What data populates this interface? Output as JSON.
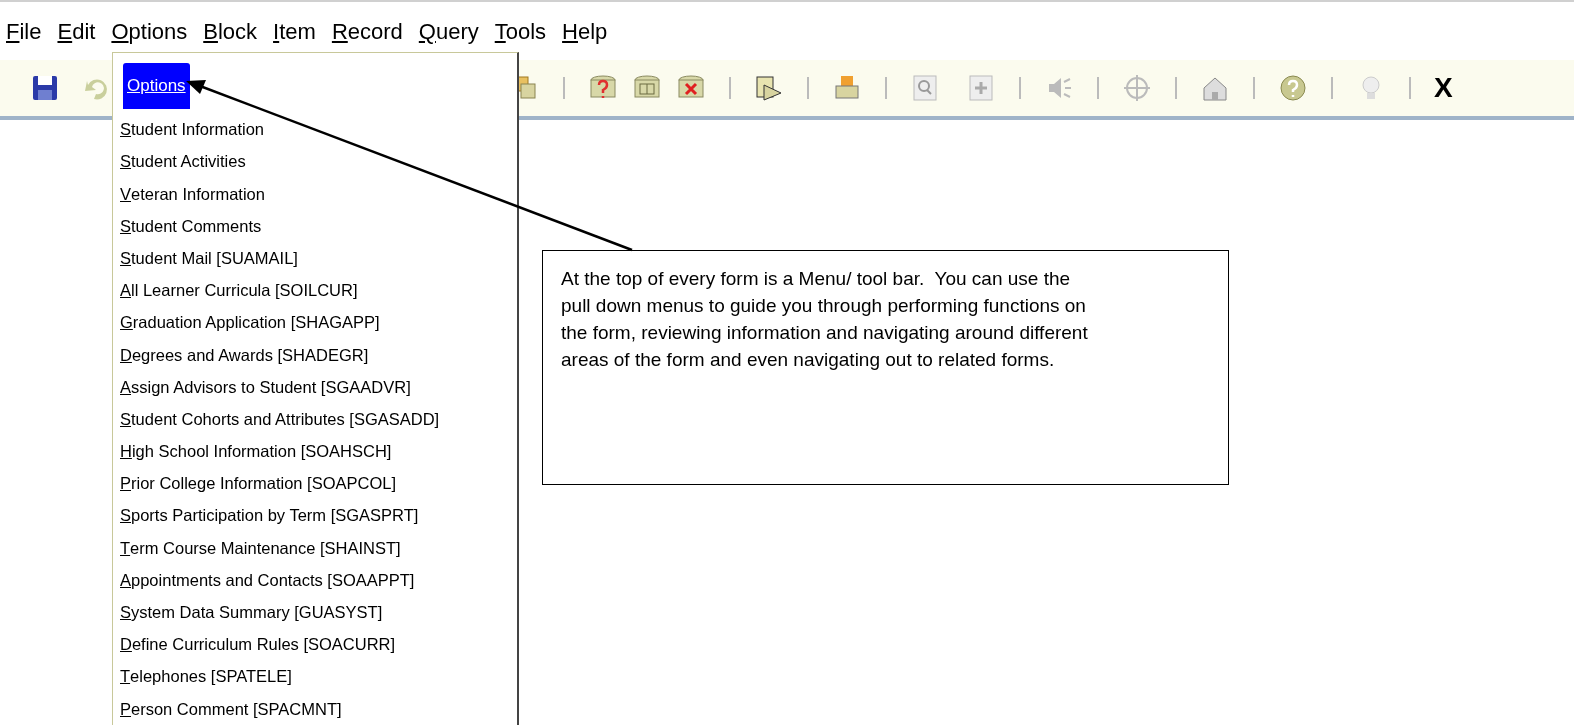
{
  "menu_bar": [
    {
      "label": "File"
    },
    {
      "label": "Edit"
    },
    {
      "label": "Options"
    },
    {
      "label": "Block"
    },
    {
      "label": "Item"
    },
    {
      "label": "Record"
    },
    {
      "label": "Query"
    },
    {
      "label": "Tools"
    },
    {
      "label": "Help"
    }
  ],
  "toolbar": {
    "exit_label": "X"
  },
  "dropdown": {
    "title": "Options",
    "items": [
      "Student Information",
      "Student Activities",
      "Veteran Information",
      "Student Comments",
      "Student Mail [SUAMAIL]",
      "All Learner Curricula [SOILCUR]",
      "Graduation Application [SHAGAPP]",
      "Degrees and Awards [SHADEGR]",
      "Assign Advisors to Student [SGAADVR]",
      "Student Cohorts and Attributes [SGASADD]",
      "High School Information [SOAHSCH]",
      "Prior College Information [SOAPCOL]",
      "Sports Participation by Term [SGASPRT]",
      "Term Course Maintenance [SHAINST]",
      "Appointments and Contacts [SOAAPPT]",
      "System Data Summary [GUASYST]",
      "Define Curriculum Rules [SOACURR]",
      "Telephones [SPATELE]",
      "Person Comment [SPACMNT]"
    ]
  },
  "callout": {
    "text": "At the top of every form is a Menu/ tool bar.  You can use the pull down menus to guide you through performing functions on the form, reviewing information and navigating around different areas of the form and even navigating out to related forms."
  }
}
